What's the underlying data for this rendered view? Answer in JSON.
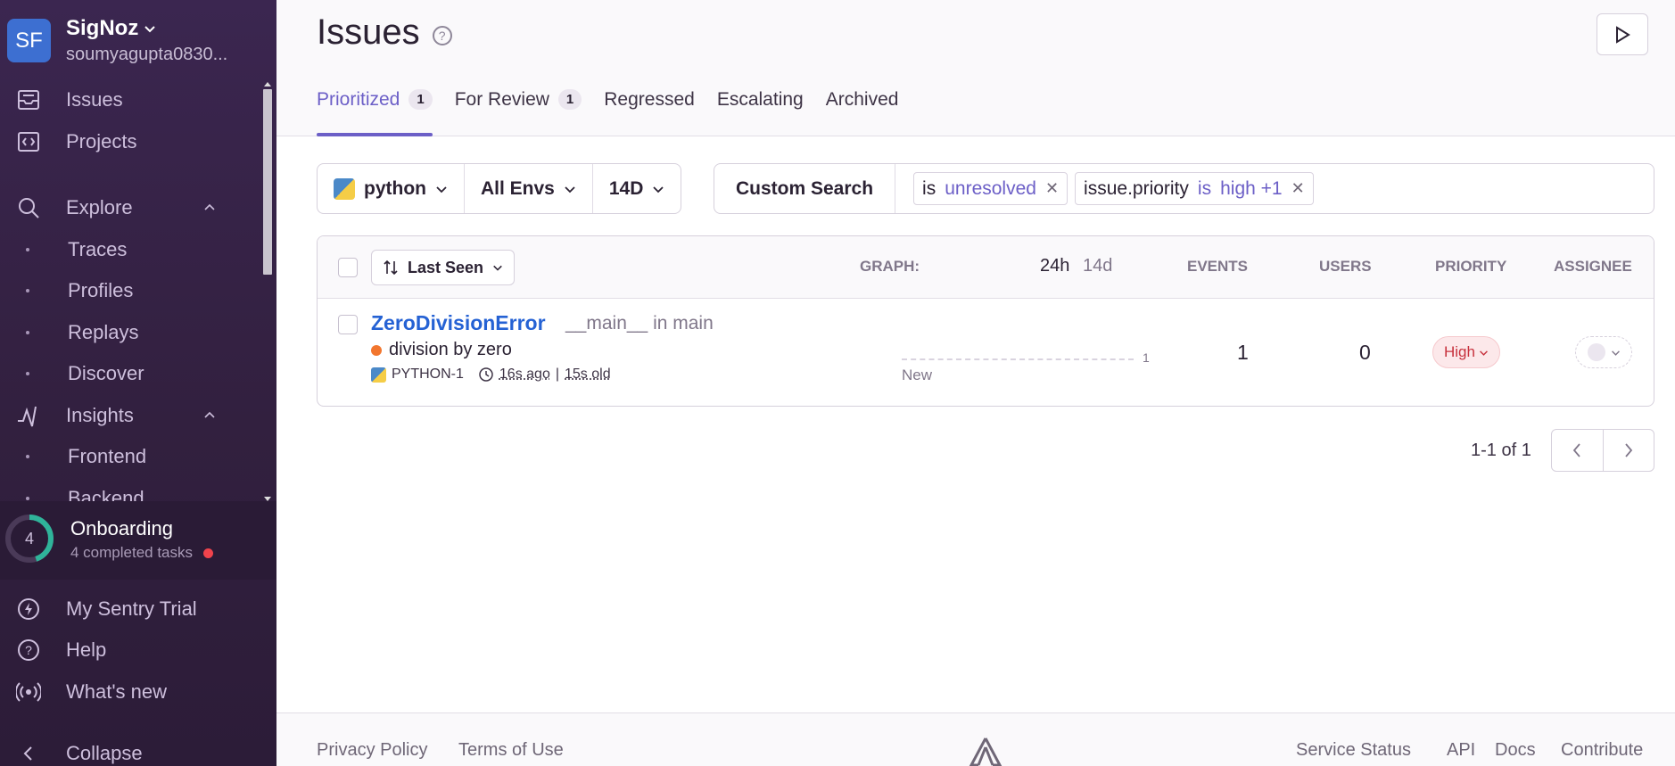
{
  "org": {
    "initials": "SF",
    "name": "SigNoz",
    "user": "soumyagupta0830..."
  },
  "nav": {
    "issues": "Issues",
    "projects": "Projects",
    "explore": "Explore",
    "traces": "Traces",
    "profiles": "Profiles",
    "replays": "Replays",
    "discover": "Discover",
    "insights": "Insights",
    "frontend": "Frontend",
    "backend": "Backend"
  },
  "onboarding": {
    "count": "4",
    "title": "Onboarding",
    "subtitle": "4 completed tasks",
    "progress": 0.45
  },
  "bottom_nav": {
    "trial": "My Sentry Trial",
    "help": "Help",
    "whats_new": "What's new",
    "collapse": "Collapse"
  },
  "page": {
    "title": "Issues",
    "help": "?"
  },
  "tabs": [
    {
      "label": "Prioritized",
      "count": "1"
    },
    {
      "label": "For Review",
      "count": "1"
    },
    {
      "label": "Regressed"
    },
    {
      "label": "Escalating"
    },
    {
      "label": "Archived"
    }
  ],
  "filters": {
    "project": "python",
    "env": "All Envs",
    "period": "14D"
  },
  "search": {
    "label": "Custom Search",
    "tokens": [
      {
        "key": "is",
        "value": "unresolved"
      },
      {
        "key": "issue.priority",
        "op": "is",
        "value": "high +1"
      }
    ]
  },
  "table": {
    "sort_label": "Last Seen",
    "graph_label": "GRAPH:",
    "period_24h": "24h",
    "period_14d": "14d",
    "col_events": "EVENTS",
    "col_users": "USERS",
    "col_priority": "PRIORITY",
    "col_assignee": "ASSIGNEE"
  },
  "issue": {
    "title": "ZeroDivisionError",
    "culprit": "__main__ in main",
    "message": "division by zero",
    "short_id": "PYTHON-1",
    "last_seen": "16s ago",
    "separator": "|",
    "age": "15s old",
    "graph_max": "1",
    "graph_new": "New",
    "events": "1",
    "users": "0",
    "priority": "High"
  },
  "pagination": {
    "label": "1-1 of 1"
  },
  "footer": {
    "privacy": "Privacy Policy",
    "terms": "Terms of Use",
    "status": "Service Status",
    "api": "API",
    "docs": "Docs",
    "contribute": "Contribute"
  }
}
